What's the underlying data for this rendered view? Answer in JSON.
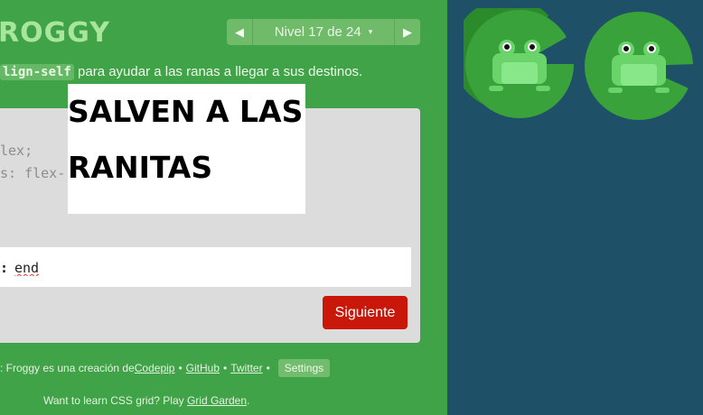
{
  "header": {
    "logo_text": "ROGGY",
    "level_label": "Nivel 17 de 24",
    "level_caret": "▾",
    "prev_arrow": "◀",
    "next_arrow": "▶"
  },
  "instructions": {
    "code": "lign-self",
    "text": " para ayudar a las ranas a llegar a sus destinos."
  },
  "editor": {
    "line1": "lex;",
    "line2": "s: flex-",
    "input_prefix": ":",
    "input_value": "end",
    "next_button": "Siguiente"
  },
  "overlay": {
    "line1": "SALVEN A LAS",
    "line2": "RANITAS"
  },
  "footer": {
    "prefix": ": Froggy es una creación de ",
    "codepip": "Codepip",
    "github": "GitHub",
    "twitter": "Twitter",
    "bullet": "•",
    "settings": "Settings",
    "grid_prefix": "Want to learn CSS grid? Play ",
    "grid_link": "Grid Garden",
    "grid_suffix": "."
  },
  "board": {
    "background": "#1e5068",
    "lilypad_color": "#3aa23a",
    "frog_color": "#6ad36a",
    "frogs": [
      "frog-icon",
      "frog-icon"
    ]
  }
}
